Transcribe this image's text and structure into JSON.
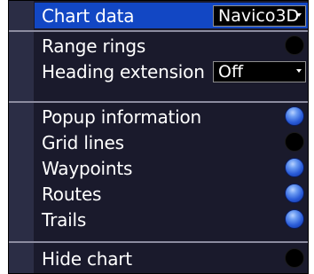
{
  "menu": {
    "chart_data": {
      "label": "Chart data",
      "value": "Navico3D"
    },
    "range_rings": {
      "label": "Range rings",
      "state": "off"
    },
    "heading_extension": {
      "label": "Heading extension",
      "value": "Off"
    },
    "popup_information": {
      "label": "Popup information",
      "state": "on"
    },
    "grid_lines": {
      "label": "Grid lines",
      "state": "off"
    },
    "waypoints": {
      "label": "Waypoints",
      "state": "on"
    },
    "routes": {
      "label": "Routes",
      "state": "on"
    },
    "trails": {
      "label": "Trails",
      "state": "on"
    },
    "hide_chart": {
      "label": "Hide chart",
      "state": "off"
    }
  },
  "colors": {
    "selection": "#1247c4",
    "panel_background": "#1a1a2c",
    "toggle_on": "#2a5cd8",
    "toggle_off": "#000000"
  }
}
